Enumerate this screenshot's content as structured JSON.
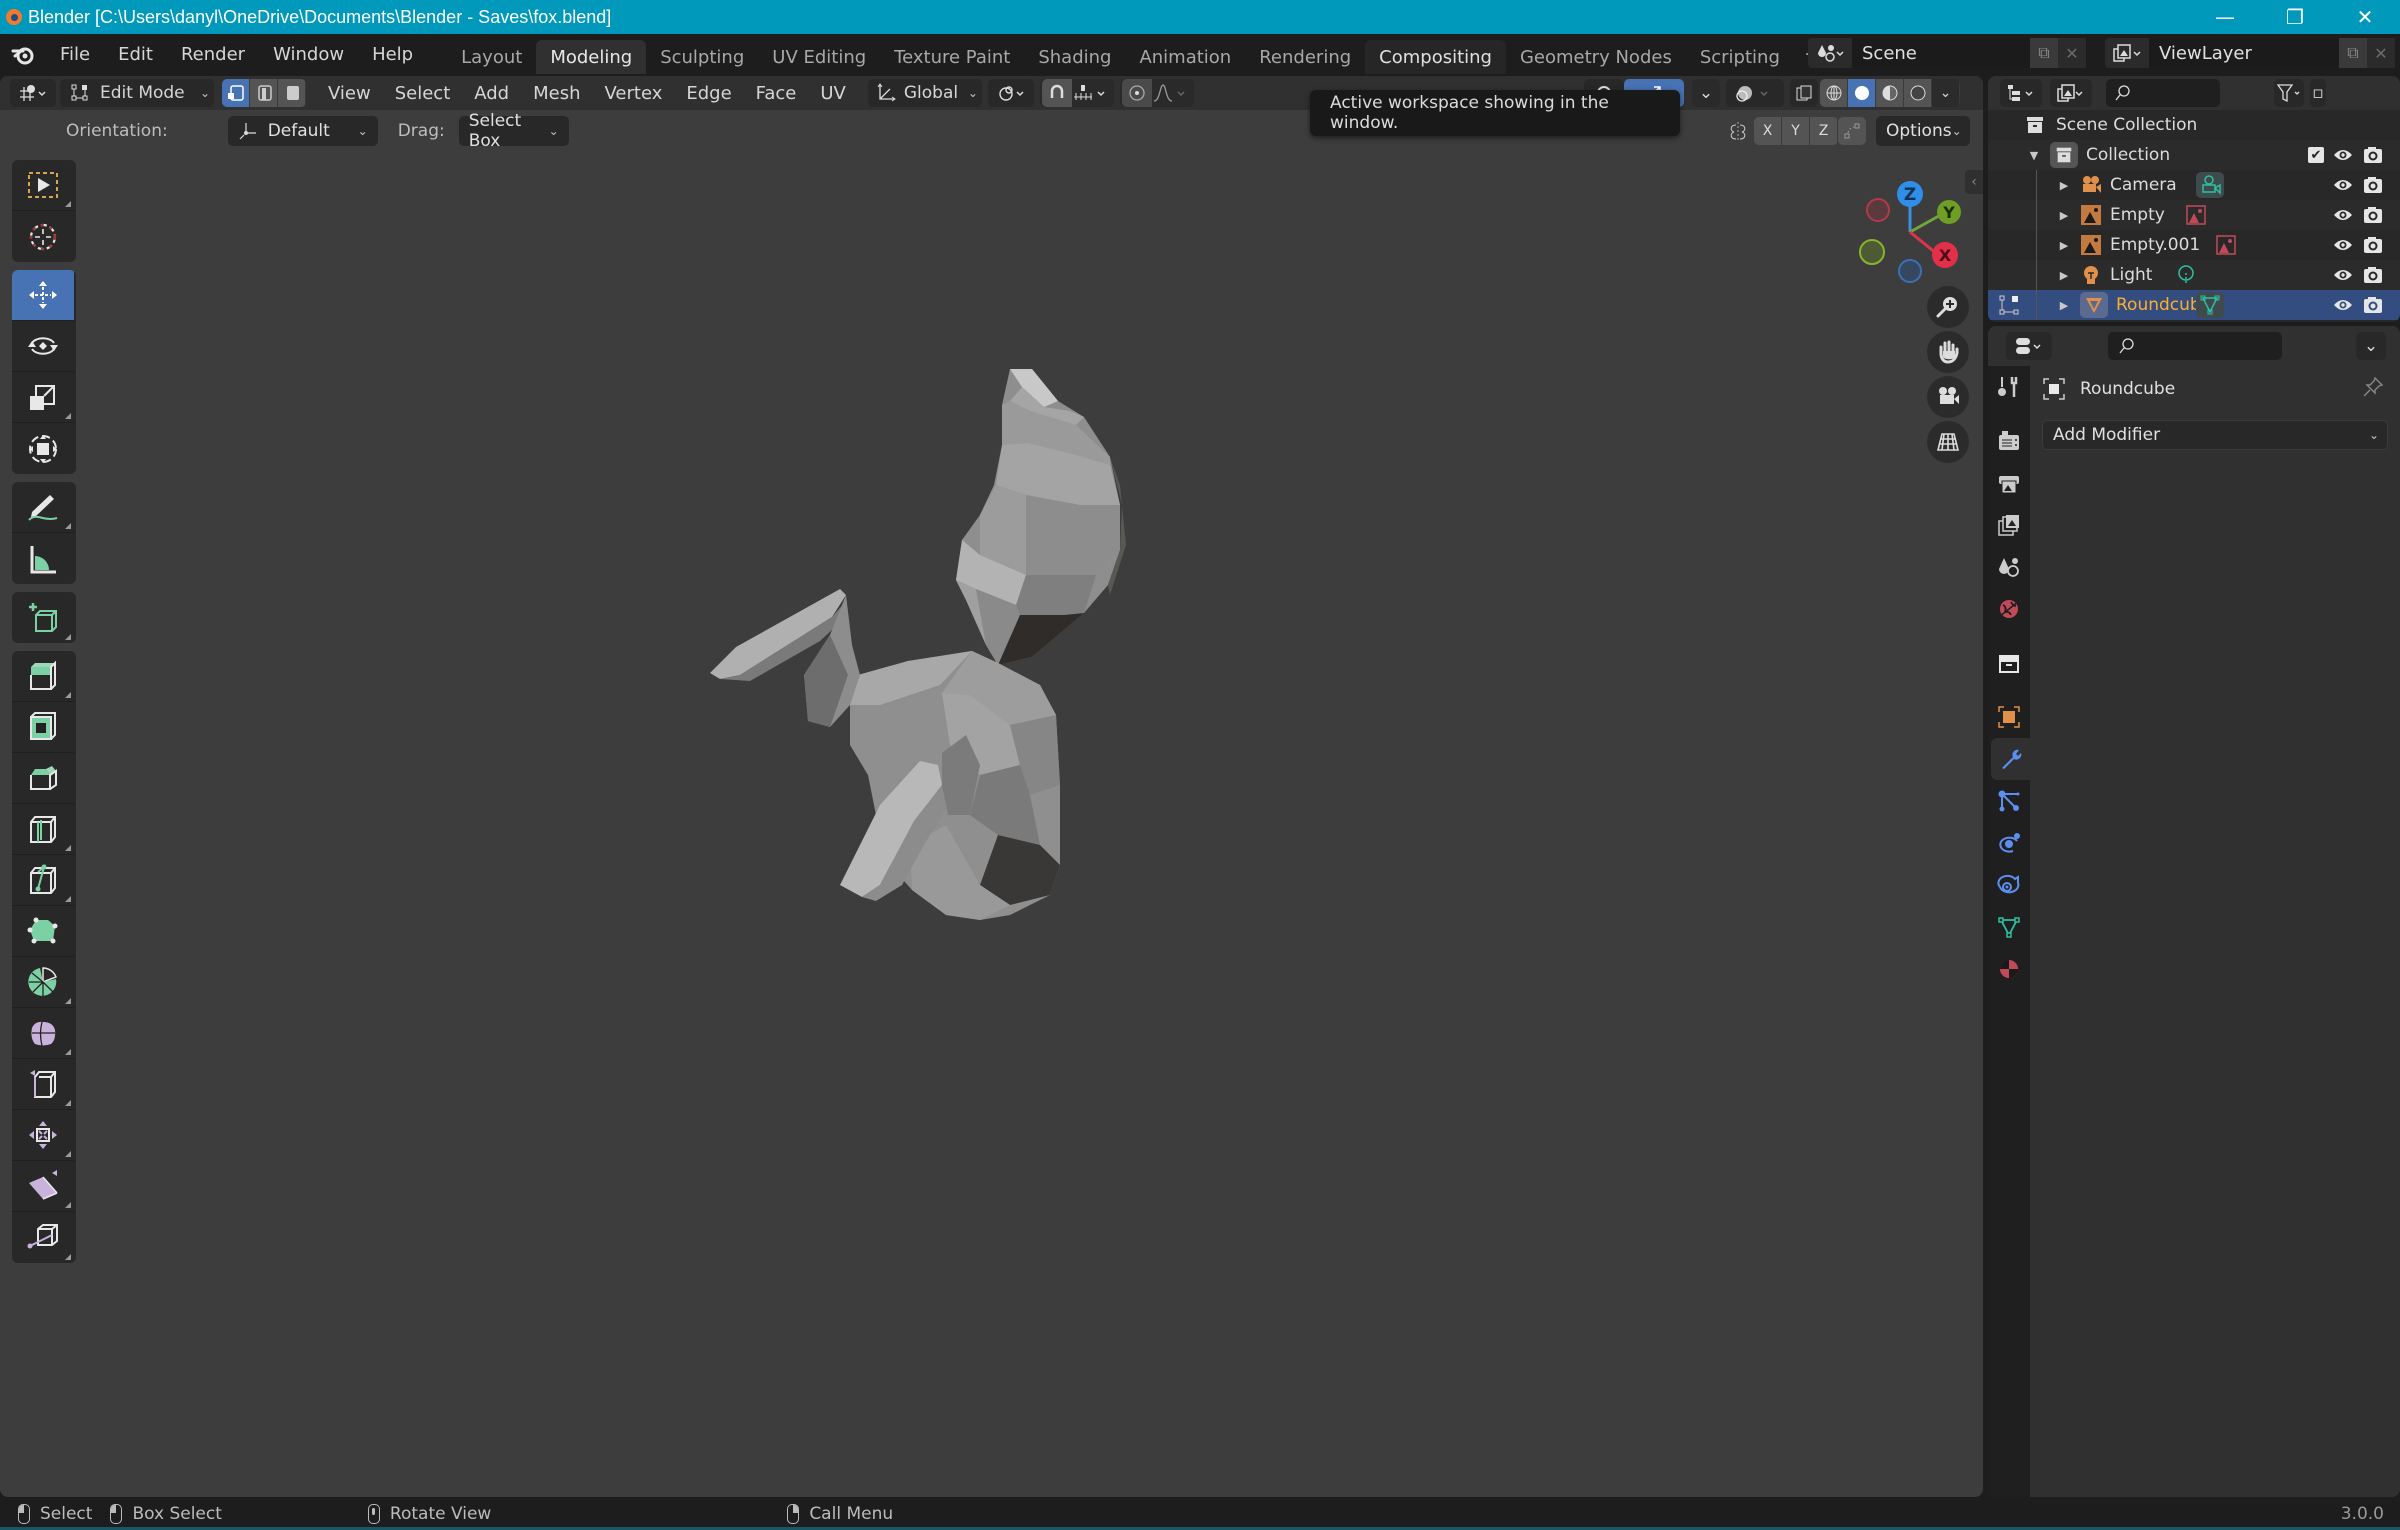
{
  "window": {
    "title": "Blender [C:\\Users\\danyl\\OneDrive\\Documents\\Blender - Saves\\fox.blend]",
    "controls": {
      "minimize": "—",
      "restore": "❐",
      "close": "✕"
    }
  },
  "menu": {
    "items": [
      "File",
      "Edit",
      "Render",
      "Window",
      "Help"
    ]
  },
  "workspaces": {
    "tabs": [
      "Layout",
      "Modeling",
      "Sculpting",
      "UV Editing",
      "Texture Paint",
      "Shading",
      "Animation",
      "Rendering",
      "Compositing",
      "Geometry Nodes",
      "Scripting"
    ],
    "active": "Modeling",
    "hovered": "Compositing",
    "add_label": "+"
  },
  "scene_selector": {
    "name": "Scene"
  },
  "viewlayer_selector": {
    "name": "ViewLayer"
  },
  "viewport_header": {
    "mode": "Edit Mode",
    "select_modes": [
      "vertex",
      "edge",
      "face"
    ],
    "active_select_mode": "vertex",
    "menus": [
      "View",
      "Select",
      "Add",
      "Mesh",
      "Vertex",
      "Edge",
      "Face",
      "UV"
    ],
    "transform_orientation": "Global",
    "orientation_label": "Orientation:",
    "orientation_value": "Default",
    "drag_label": "Drag:",
    "drag_value": "Select Box",
    "mirror_axes": [
      "X",
      "Y",
      "Z"
    ],
    "options_label": "Options",
    "shading_modes": [
      "wireframe",
      "solid",
      "material-preview",
      "rendered"
    ],
    "active_shading": "solid"
  },
  "tooltip": {
    "text": "Active workspace showing in the window."
  },
  "toolbar": {
    "tools": [
      {
        "name": "select-box",
        "group": 1
      },
      {
        "name": "cursor",
        "group": 1
      },
      {
        "name": "move",
        "group": 2,
        "active": true
      },
      {
        "name": "rotate",
        "group": 2
      },
      {
        "name": "scale",
        "group": 2
      },
      {
        "name": "transform",
        "group": 2
      },
      {
        "name": "annotate",
        "group": 3
      },
      {
        "name": "measure",
        "group": 3
      },
      {
        "name": "add-cube",
        "group": 4
      },
      {
        "name": "extrude-region",
        "group": 5
      },
      {
        "name": "inset-faces",
        "group": 5
      },
      {
        "name": "bevel",
        "group": 5
      },
      {
        "name": "loop-cut",
        "group": 5
      },
      {
        "name": "knife",
        "group": 5
      },
      {
        "name": "poly-build",
        "group": 5
      },
      {
        "name": "spin",
        "group": 5
      },
      {
        "name": "smooth",
        "group": 5
      },
      {
        "name": "edge-slide",
        "group": 5
      },
      {
        "name": "shrink-fatten",
        "group": 5
      },
      {
        "name": "shear",
        "group": 5
      },
      {
        "name": "rip-region",
        "group": 5
      }
    ]
  },
  "gizmo": {
    "axes": [
      "Z",
      "Y",
      "X"
    ]
  },
  "nav_buttons": [
    "zoom",
    "pan",
    "camera-view",
    "toggle-perspective"
  ],
  "outliner": {
    "search_placeholder": "",
    "root": "Scene Collection",
    "collection": "Collection",
    "objects": [
      {
        "name": "Camera",
        "type": "camera",
        "data": "camera-data"
      },
      {
        "name": "Empty",
        "type": "empty-image",
        "data": "image"
      },
      {
        "name": "Empty.001",
        "type": "empty-image",
        "data": "image"
      },
      {
        "name": "Light",
        "type": "light",
        "data": "light-data"
      },
      {
        "name": "Roundcube",
        "type": "mesh",
        "data": "mesh-data",
        "selected": true
      }
    ]
  },
  "properties": {
    "search_placeholder": "",
    "object_name": "Roundcube",
    "add_modifier_label": "Add Modifier",
    "tabs": [
      "tool",
      "render",
      "output",
      "view-layer",
      "scene",
      "world",
      "collection",
      "object",
      "modifiers",
      "particles",
      "physics",
      "constraints",
      "data",
      "material"
    ],
    "active_tab": "modifiers"
  },
  "statusbar": {
    "hints": [
      {
        "mouse": "left",
        "label": "Select"
      },
      {
        "mouse": "left-drag",
        "label": "Box Select"
      },
      {
        "mouse": "middle",
        "label": "Rotate View"
      },
      {
        "mouse": "right",
        "label": "Call Menu"
      }
    ],
    "version": "3.0.0"
  },
  "colors": {
    "titlebar": "#0099bc",
    "accent": "#4772b3",
    "selected_row": "#334d80",
    "selected_text": "#ffaf29",
    "viewport_bg": "#3d3d3d"
  }
}
